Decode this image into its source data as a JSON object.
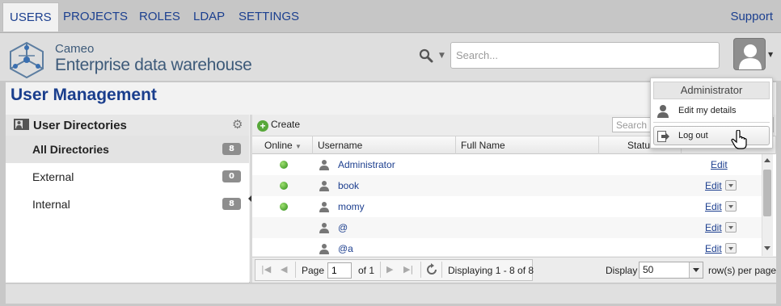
{
  "nav": {
    "tabs": [
      {
        "label": "USERS",
        "active": true
      },
      {
        "label": "PROJECTS"
      },
      {
        "label": "ROLES"
      },
      {
        "label": "LDAP"
      },
      {
        "label": "SETTINGS"
      }
    ],
    "support": "Support"
  },
  "brand": {
    "line1": "Cameo",
    "line2": "Enterprise data warehouse"
  },
  "search": {
    "placeholder": "Search..."
  },
  "page_title": "User Management",
  "directories": {
    "title": "User Directories",
    "items": [
      {
        "label": "All Directories",
        "count": "8",
        "selected": true
      },
      {
        "label": "External",
        "count": "0"
      },
      {
        "label": "Internal",
        "count": "8"
      }
    ]
  },
  "grid": {
    "create_label": "Create",
    "search_placeholder": "Search b",
    "columns": {
      "online": "Online",
      "username": "Username",
      "full_name": "Full Name",
      "status": "Status"
    },
    "rows": [
      {
        "online": true,
        "username": "Administrator",
        "edit": "Edit"
      },
      {
        "online": true,
        "username": "book",
        "edit": "Edit"
      },
      {
        "online": true,
        "username": "momy",
        "edit": "Edit"
      },
      {
        "online": false,
        "username": "@",
        "edit": "Edit"
      },
      {
        "online": false,
        "username": "@a",
        "edit": "Edit"
      }
    ]
  },
  "pager": {
    "page_label": "Page",
    "page_value": "1",
    "of_label": "of 1",
    "display_info": "Displaying 1 - 8 of 8",
    "display_label": "Display",
    "per_page": "50",
    "rows_per_page_label": "row(s) per page"
  },
  "user_menu": {
    "title": "Administrator",
    "edit_details": "Edit my details",
    "logout": "Log out"
  },
  "colors": {
    "accent": "#1a3e8d",
    "online": "#3a9a1e",
    "badge": "#8e8e8e"
  }
}
